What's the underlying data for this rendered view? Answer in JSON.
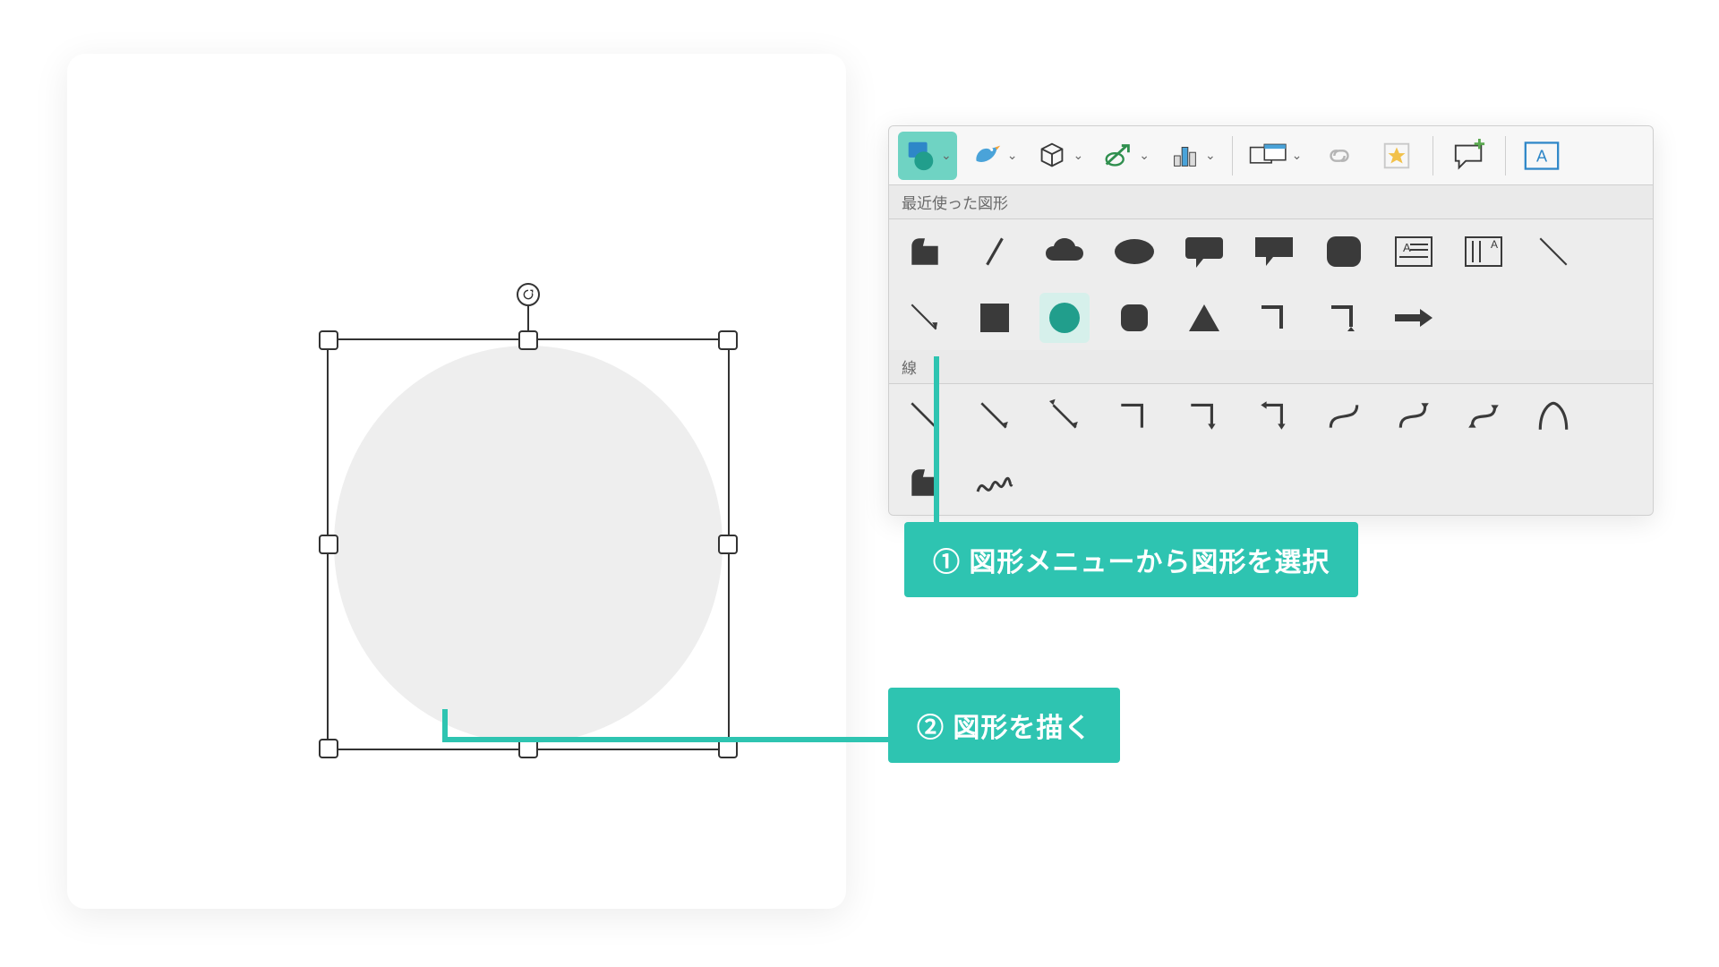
{
  "canvas": {
    "shape_name": "circle"
  },
  "ribbon": {
    "section_recent": "最近使った図形",
    "section_lines": "線",
    "toolbar": {
      "shapes_menu": "shapes-menu",
      "icons": [
        "icons-menu",
        "3d-menu",
        "smartart-menu",
        "chart-menu",
        "screenshot-menu",
        "link",
        "action",
        "new-comment",
        "text-box"
      ]
    },
    "recent_shapes": [
      "tab-shape",
      "line",
      "cloud",
      "oval-filled",
      "rounded-callout",
      "rect-callout",
      "rounded-rect",
      "text-box-shape",
      "vertical-text-box",
      "line-thin",
      "line-arrow",
      "square-filled",
      "circle",
      "rounded-square",
      "triangle",
      "elbow-down",
      "elbow-right",
      "arrow-right"
    ],
    "lines": [
      "line",
      "line-arrow",
      "line-double-arrow",
      "elbow",
      "elbow-arrow",
      "elbow-double-arrow",
      "curve",
      "curve-arrow",
      "curve-double-arrow",
      "arc",
      "freeform",
      "scribble"
    ]
  },
  "callouts": {
    "step1": "① 図形メニューから図形を選択",
    "step2": "② 図形を描く"
  },
  "colors": {
    "accent": "#2ec4b1",
    "accent_light": "#6fd3c3",
    "shape_fill": "#eeeeee",
    "icon": "#3a3a3a"
  }
}
